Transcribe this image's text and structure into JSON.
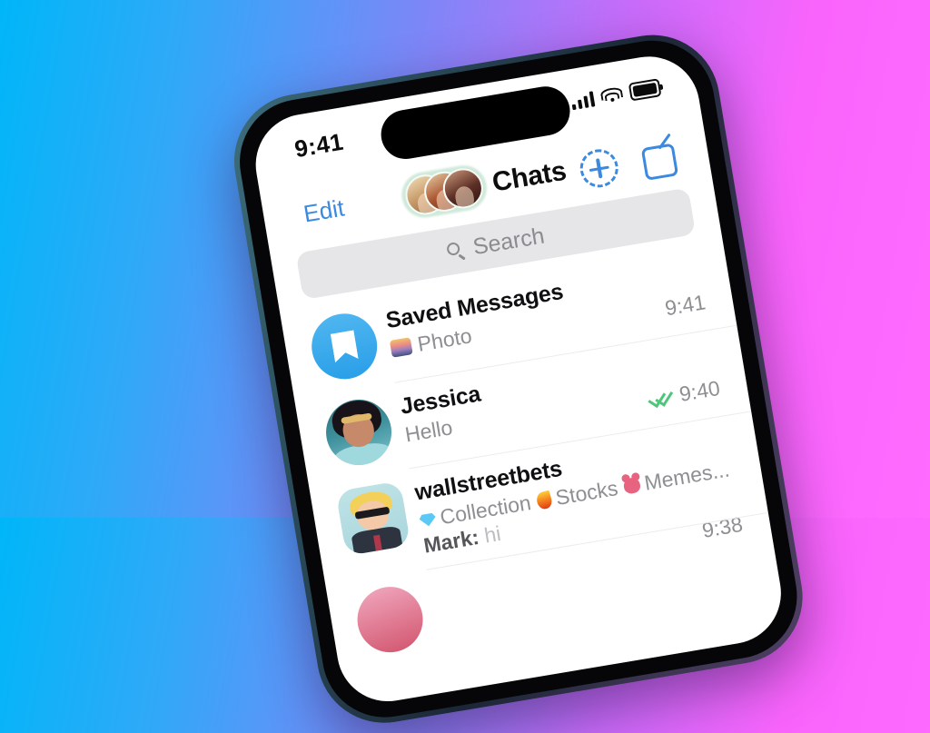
{
  "background": {
    "from": "#00B6F8",
    "to": "#FF6BFF"
  },
  "statusbar": {
    "time": "9:41",
    "signal_icon": "cellular-signal-icon",
    "wifi_icon": "wifi-icon",
    "battery_icon": "battery-full-icon"
  },
  "navbar": {
    "edit_label": "Edit",
    "title": "Chats",
    "story_ring_color": "#cfe9da",
    "new_chat_icon": "plus-circle-dashed-icon",
    "compose_icon": "compose-pencil-square-icon",
    "accent": "#3b8ae0"
  },
  "search": {
    "placeholder": "Search",
    "icon": "search-icon"
  },
  "chats": [
    {
      "name": "Saved Messages",
      "avatar": "saved-messages-bookmark-icon",
      "subtitle": "Photo",
      "attachment_icon": "photo-thumbnail-icon",
      "time": "9:41",
      "read_status": ""
    },
    {
      "name": "Jessica",
      "avatar": "contact-photo-jessica",
      "subtitle": "Hello",
      "time": "9:40",
      "read_status": "double-check-icon"
    },
    {
      "name": "wallstreetbets",
      "avatar": "group-photo-wallstreetbets",
      "tags": [
        {
          "label": "Collection",
          "icon": "gem-icon"
        },
        {
          "label": "Stocks",
          "icon": "fire-icon"
        },
        {
          "label": "Memes...",
          "icon": "meme-face-icon"
        }
      ],
      "message_sender": "Mark:",
      "message_text": "hi",
      "time": "9:38",
      "read_status": ""
    }
  ]
}
